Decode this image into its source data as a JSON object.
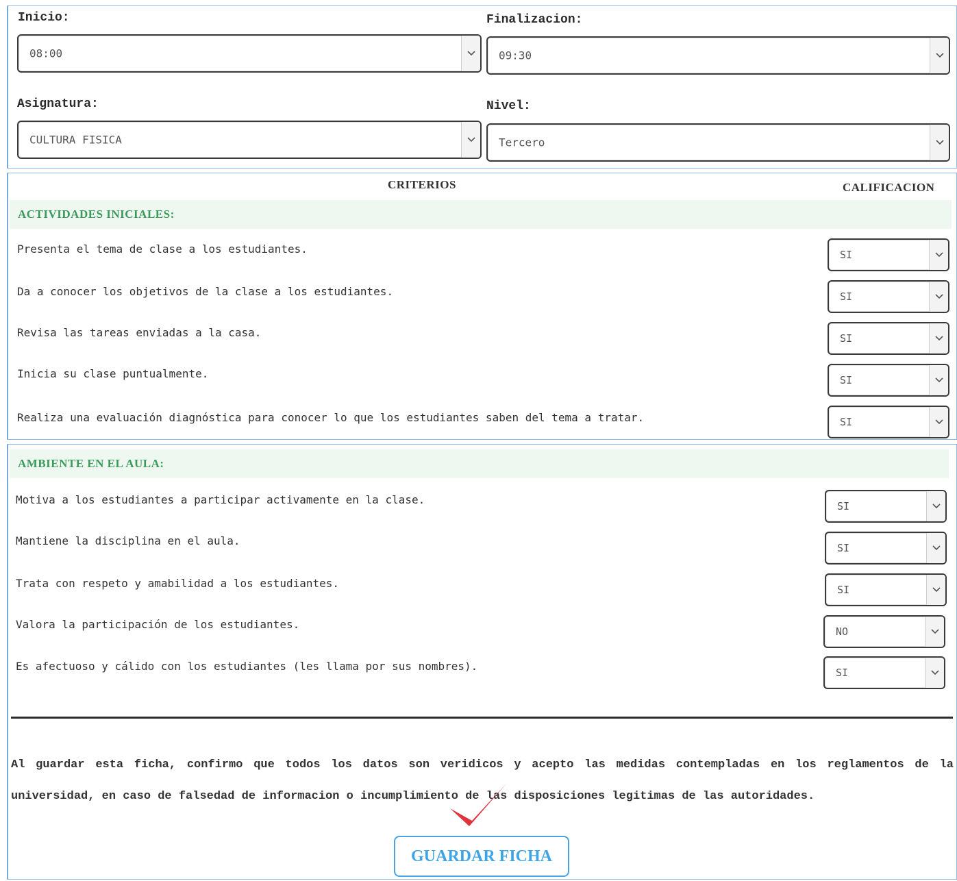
{
  "schedule": {
    "start_label": "Inicio:",
    "start_value": "08:00",
    "end_label": "Finalizacion:",
    "end_value": "09:30",
    "subject_label": "Asignatura:",
    "subject_value": "CULTURA FISICA",
    "level_label": "Nivel:",
    "level_value": "Tercero"
  },
  "criteria_header": {
    "criterios": "CRITERIOS",
    "calificacion": "CALIFICACION"
  },
  "sections": [
    {
      "title": "ACTIVIDADES INICIALES:",
      "items": [
        {
          "text": "Presenta el tema de clase a los estudiantes.",
          "value": "SI"
        },
        {
          "text": "Da a conocer los objetivos de la clase a los estudiantes.",
          "value": "SI"
        },
        {
          "text": "Revisa las tareas enviadas a la casa.",
          "value": "SI"
        },
        {
          "text": "Inicia su clase puntualmente.",
          "value": "SI"
        },
        {
          "text": "Realiza una evaluación diagnóstica para conocer lo que los estudiantes saben del tema a tratar.",
          "value": "SI"
        }
      ]
    },
    {
      "title": "AMBIENTE EN EL AULA:",
      "items": [
        {
          "text": "Motiva a los estudiantes a participar activamente en la clase.",
          "value": "SI"
        },
        {
          "text": "Mantiene la disciplina en el aula.",
          "value": "SI"
        },
        {
          "text": "Trata con respeto y amabilidad a los estudiantes.",
          "value": "SI"
        },
        {
          "text": "Valora la participación de los estudiantes.",
          "value": "NO"
        },
        {
          "text": "Es afectuoso y cálido con los estudiantes (les llama por sus nombres).",
          "value": "SI"
        }
      ]
    }
  ],
  "disclaimer": "Al guardar esta ficha, confirmo que todos los datos son veridicos y acepto las medidas contempladas en los reglamentos de la universidad, en caso de falsedad de informacion o incumplimiento de las disposiciones legitimas de las autoridades.",
  "save_button": "GUARDAR FICHA",
  "colors": {
    "section_title": "#3a9a5a",
    "section_bg": "#eef8f1",
    "button_accent": "#3fa4e6",
    "annotation_check": "#e0323a"
  }
}
